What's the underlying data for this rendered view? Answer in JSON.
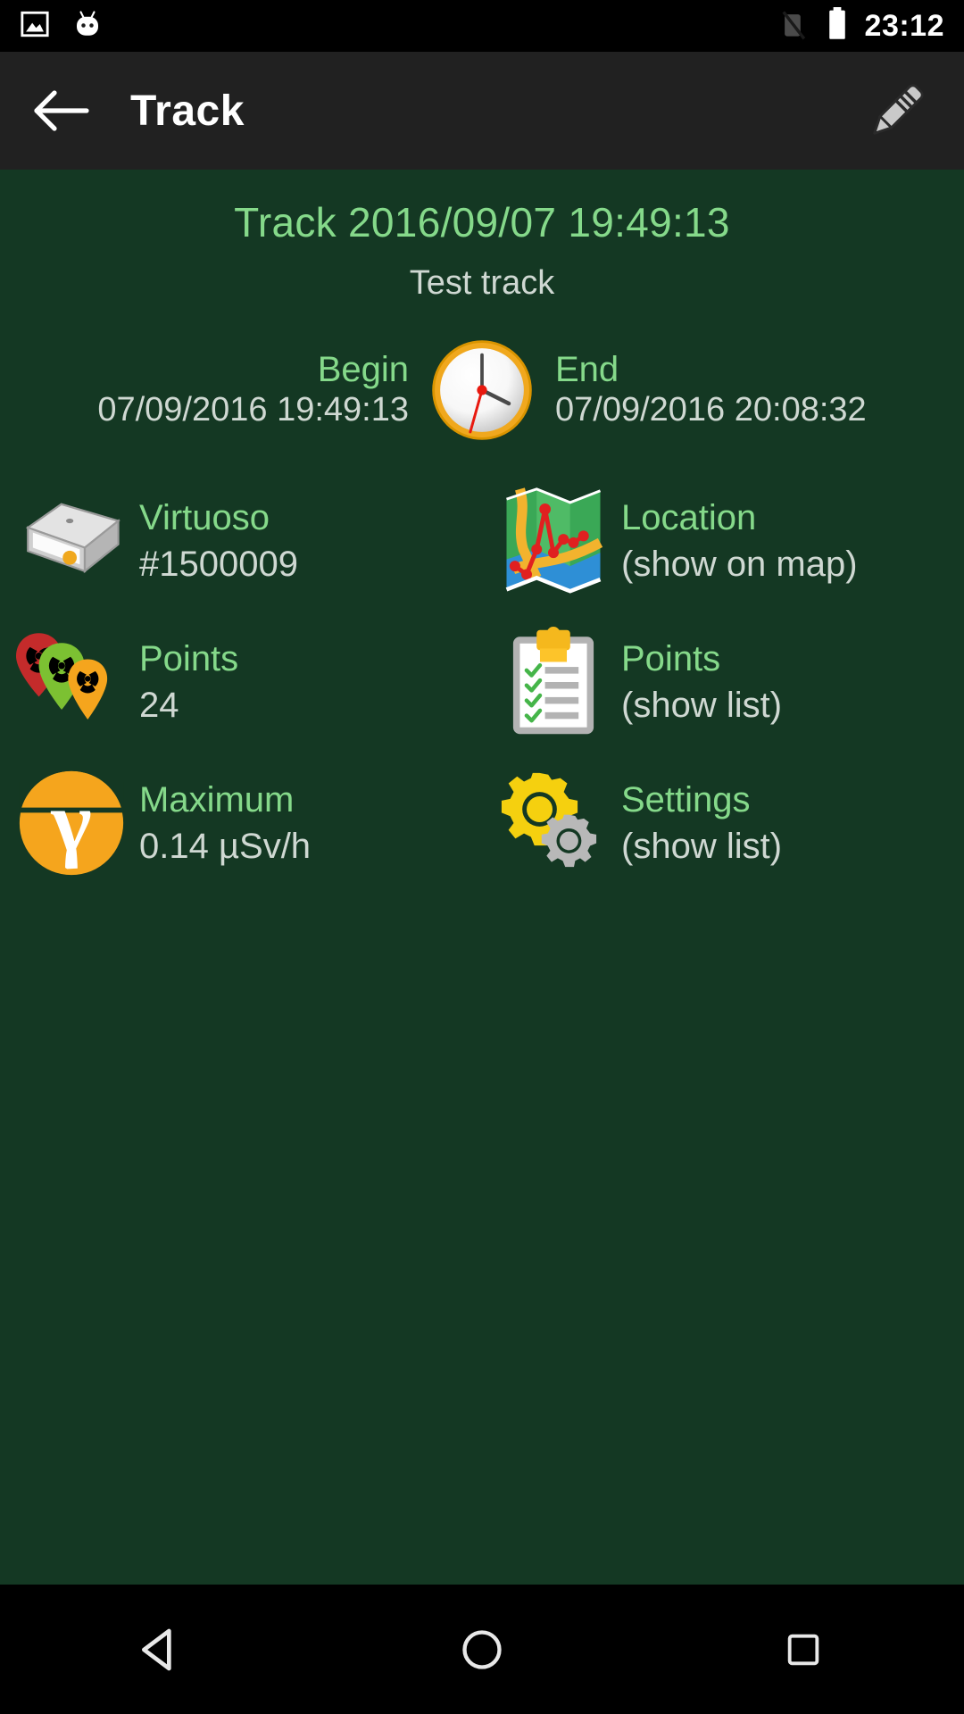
{
  "statusbar": {
    "time": "23:12",
    "icons": {
      "screenshot": "image-icon",
      "android": "android-bugdroid-icon",
      "signal_off": "signal-off-icon",
      "battery": "battery-full-icon"
    }
  },
  "appbar": {
    "back": "back-arrow-icon",
    "title": "Track",
    "edit": "pencil-edit-icon"
  },
  "track": {
    "title": "Track 2016/09/07 19:49:13",
    "subtitle": "Test track",
    "begin_label": "Begin",
    "begin_value": "07/09/2016 19:49:13",
    "end_label": "End",
    "end_value": "07/09/2016 20:08:32",
    "clock_icon": "clock-icon"
  },
  "info": [
    {
      "icon": "device-box-icon",
      "title": "Virtuoso",
      "value": "#1500009"
    },
    {
      "icon": "map-icon",
      "title": "Location",
      "value": "(show on map)"
    },
    {
      "icon": "radiation-pins-icon",
      "title": "Points",
      "value": "24"
    },
    {
      "icon": "clipboard-icon",
      "title": "Points",
      "value": "(show list)"
    },
    {
      "icon": "gamma-icon",
      "title": "Maximum",
      "value": "0.14 µSv/h"
    },
    {
      "icon": "gears-icon",
      "title": "Settings",
      "value": "(show list)"
    }
  ],
  "navbar": {
    "back": "nav-back-icon",
    "home": "nav-home-icon",
    "recents": "nav-recents-icon"
  },
  "colors": {
    "background": "#143823",
    "appbar": "#212121",
    "statusbar": "#000000",
    "accent_green": "#85d98a",
    "value_text": "#cfd8d2"
  }
}
